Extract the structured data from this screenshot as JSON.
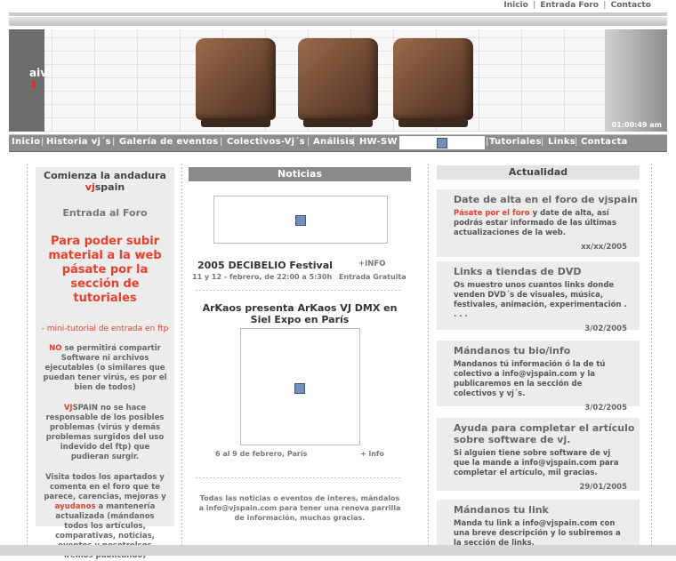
{
  "toplinks": {
    "inicio": "Inicio",
    "entrada_foro": "Entrada Foro",
    "contacto": "Contacto",
    "sep": "|"
  },
  "banner": {
    "logo": "aiv",
    "clock": "01:00:49 am"
  },
  "nav": {
    "items": [
      "Inicio",
      "Historia vj´s",
      "Galería de eventos",
      "Colectivos-Vj´s",
      "Análisis",
      "HW-SW",
      "Tutoriales",
      "Links",
      "Contacta"
    ],
    "sep": "|"
  },
  "left": {
    "title_a": "Comienza la andadura",
    "title_b": "vjspain",
    "title_b_red": "vj",
    "title_b_rest": "spain",
    "entrada": "Entrada al Foro",
    "cta": "Para poder subir material a la web pásate por la sección de tutoriales",
    "mini": "- mini-tutorial de entrada en ftp",
    "p1_red": "NO",
    "p1": " se permitirá compartir Software ni archivos ejecutables (o similares que puedan tener virús, es por el bien de todos)",
    "p2_red": "VJ",
    "p2_mid": "SPAIN",
    "p2": " no se hace responsable de los posibles problemas (virús y demás problemas surgidos del uso indevido del ftp) que pudieran surgir.",
    "p3a": "Visita todos los apartados y comenta en el foro que te parece, carencias, mejoras y ",
    "p3_red": "ayudanos",
    "p3b": " a mantenería actualizada (mándanos todos los artículos, comparativas, noticias, eventos y nosotrolsos iremos publicando)"
  },
  "center": {
    "header": "Noticias",
    "n1_title": "2005 DECIBELIO Festival",
    "n1_more": "+INFO",
    "n1_date": "11 y 12 - febrero, de 22:00 a 5:30h",
    "n1_entry": "Entrada Gratuita",
    "n2_title": "ArKaos presenta ArKaos VJ DMX en Siel Expo en París",
    "n2_date": "6 al 9 de febrero, París",
    "n2_more": "+ info",
    "footer": "Todas las noticias o eventos de interes, mándalos a info@vjspain.com para tener una renova parrilla de información, muchas gracias."
  },
  "right": {
    "header": "Actualidad",
    "cards": [
      {
        "title": "Date de alta en el foro de vjspain",
        "body_red": "Pásate por el foro",
        "body": " y date de alta, así podrás estar informado de las últimas actualizaciones de la web.",
        "date": "xx/xx/2005"
      },
      {
        "title": "Links a tiendas de DVD",
        "body_red": "",
        "body": "Os muestro unos cuantos links donde venden DVD´s de visuales, música, festivales, animación, experimentación . . . .",
        "date": "3/02/2005"
      },
      {
        "title": "Mándanos tu bio/info",
        "body_red": "",
        "body": "Mandanos tú información ó la de tú colectivo a info@vjspain.com y la publicaremos en la sección de colectivos y vj´s.",
        "date": "3/02/2005"
      },
      {
        "title": "Ayuda para completar el artículo sobre software de vj.",
        "body_red": "",
        "body": "Si alguien tiene sobre software de vj que la mande a info@vjspain.com para completar el artículo, mil gracias.",
        "date": "29/01/2005"
      },
      {
        "title": "Mándanos tu link",
        "body_red": "",
        "body": "Manda tu link a info@vjspain.com con una breve descripción y lo subiremos a la sección de links.",
        "date": ""
      }
    ]
  }
}
